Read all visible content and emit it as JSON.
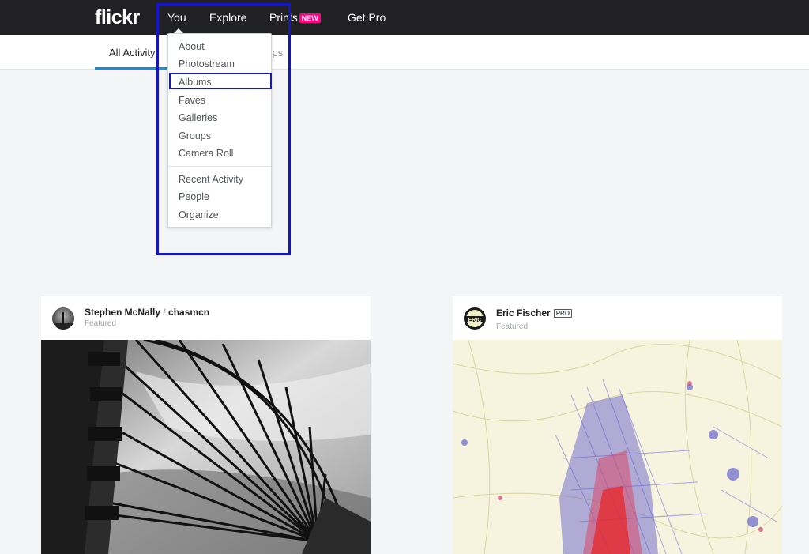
{
  "topnav": {
    "logo": "flickr",
    "items": [
      {
        "label": "You"
      },
      {
        "label": "Explore"
      },
      {
        "label": "Prints",
        "badge": "NEW"
      },
      {
        "label": "Get Pro"
      }
    ]
  },
  "subnav": {
    "tabs": [
      {
        "label": "All Activity",
        "active": true
      },
      {
        "label": "oups"
      }
    ]
  },
  "dropdown": {
    "items": [
      "About",
      "Photostream",
      "Albums",
      "Faves",
      "Galleries",
      "Groups",
      "Camera Roll",
      "Recent Activity",
      "People",
      "Organize"
    ],
    "highlighted": "Albums"
  },
  "cards": [
    {
      "author": "Stephen McNally",
      "username": "chasmcn",
      "status": "Featured"
    },
    {
      "author": "Eric Fischer",
      "pro_badge": "PRO",
      "status": "Featured"
    }
  ],
  "colors": {
    "nav_bg": "#212124",
    "accent_blue": "#128fdc",
    "new_badge": "#ff0084",
    "annotation_blue": "#1515c8"
  }
}
